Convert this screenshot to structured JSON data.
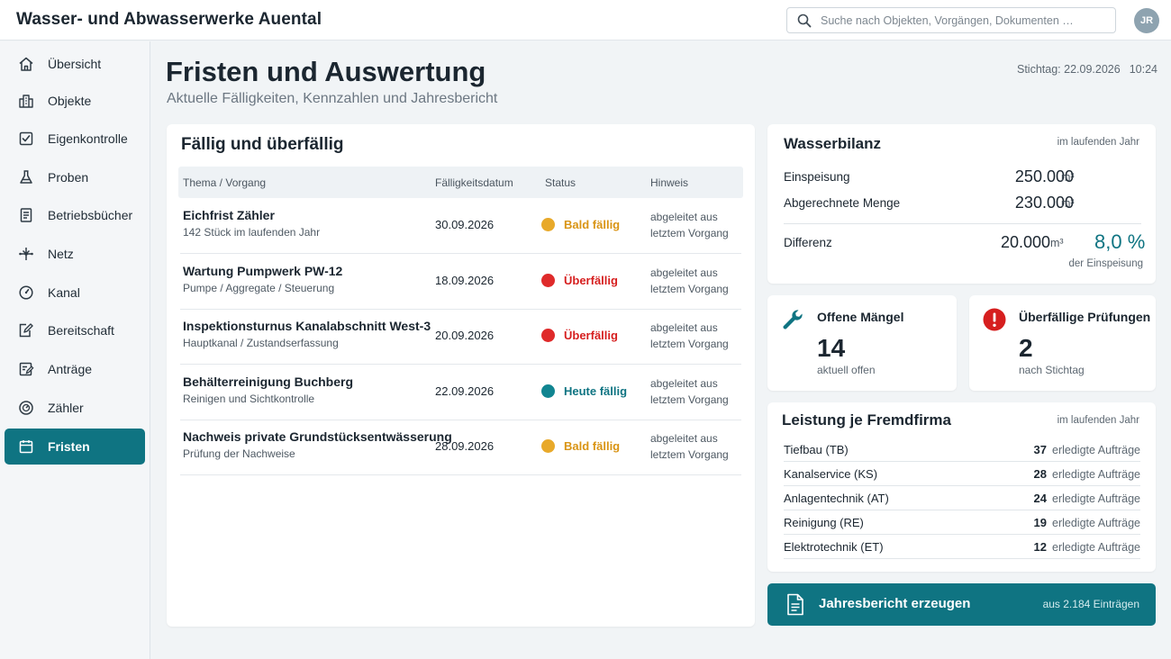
{
  "app": {
    "title": "Wasser- und Abwasserwerke Auental"
  },
  "search": {
    "placeholder": "Suche nach Objekten, Vorgängen, Dokumenten …"
  },
  "user": {
    "initials": "JR"
  },
  "sidebar": {
    "items": [
      {
        "label": "Übersicht",
        "icon": "home-icon"
      },
      {
        "label": "Objekte",
        "icon": "building-icon"
      },
      {
        "label": "Eigenkontrolle",
        "icon": "checkbox-icon"
      },
      {
        "label": "Proben",
        "icon": "flask-icon"
      },
      {
        "label": "Betriebsbücher",
        "icon": "document-icon"
      },
      {
        "label": "Netz",
        "icon": "network-icon"
      },
      {
        "label": "Kanal",
        "icon": "gauge-icon"
      },
      {
        "label": "Bereitschaft",
        "icon": "edit-document-icon"
      },
      {
        "label": "Anträge",
        "icon": "form-icon"
      },
      {
        "label": "Zähler",
        "icon": "meter-icon"
      },
      {
        "label": "Fristen",
        "icon": "calendar-icon",
        "active": true
      }
    ]
  },
  "header": {
    "title": "Fristen und Auswertung",
    "subtitle": "Aktuelle Fälligkeiten, Kennzahlen und Jahresbericht",
    "stichtag": "Stichtag: 22.09.2026",
    "time": "10:24"
  },
  "due": {
    "title": "Fällig und überfällig",
    "columns": [
      "Thema / Vorgang",
      "Fälligkeitsdatum",
      "Status",
      "Hinweis"
    ],
    "rows": [
      {
        "title": "Eichfrist Zähler",
        "sub": "142 Stück im laufenden Jahr",
        "date": "30.09.2026",
        "status": "Bald fällig",
        "hint": "abgeleitet aus letztem Vorgang"
      },
      {
        "title": "Wartung Pumpwerk PW-12",
        "sub": "Pumpe / Aggregate / Steuerung",
        "date": "18.09.2026",
        "status": "Überfällig",
        "hint": "abgeleitet aus letztem Vorgang"
      },
      {
        "title": "Inspektionsturnus Kanalabschnitt West-3",
        "sub": "Hauptkanal / Zustandserfassung",
        "date": "20.09.2026",
        "status": "Überfällig",
        "hint": "abgeleitet aus letztem Vorgang"
      },
      {
        "title": "Behälterreinigung Buchberg",
        "sub": "Reinigen und Sichtkontrolle",
        "date": "22.09.2026",
        "status": "Heute fällig",
        "hint": "abgeleitet aus letztem Vorgang"
      },
      {
        "title": "Nachweis private Grundstücksentwässerung",
        "sub": "Prüfung der Nachweise",
        "date": "28.09.2026",
        "status": "Bald fällig",
        "hint": "abgeleitet aus letztem Vorgang"
      }
    ]
  },
  "status_colors": {
    "Bald fällig": "#e8a92a",
    "Überfällig": "#df2a2a",
    "Heute fällig": "#118591"
  },
  "status_text_colors": {
    "Bald fällig": "#d99414",
    "Überfällig": "#d61f1f",
    "Heute fällig": "#0f7482"
  },
  "wasserbilanz": {
    "title": "Wasserbilanz",
    "period": "im laufenden Jahr",
    "einspeisung_label": "Einspeisung",
    "einspeisung_value": "250.000",
    "abgerechnet_label": "Abgerechnete Menge",
    "abgerechnet_value": "230.000",
    "differenz_label": "Differenz",
    "differenz_value": "20.000",
    "unit": "m³",
    "percent": "8,0 %",
    "percent_note": "der Einspeisung"
  },
  "kpis": {
    "maengel": {
      "title": "Offene Mängel",
      "value": "14",
      "sub": "aktuell offen"
    },
    "pruefungen": {
      "title": "Überfällige Prüfungen",
      "value": "2",
      "sub": "nach Stichtag"
    }
  },
  "fremdfirma": {
    "title": "Leistung je Fremdfirma",
    "period": "im laufenden Jahr",
    "unit": "erledigte Aufträge",
    "rows": [
      {
        "name": "Tiefbau (TB)",
        "count": "37"
      },
      {
        "name": "Kanalservice (KS)",
        "count": "28"
      },
      {
        "name": "Anlagentechnik (AT)",
        "count": "24"
      },
      {
        "name": "Reinigung (RE)",
        "count": "19"
      },
      {
        "name": "Elektrotechnik (ET)",
        "count": "12"
      }
    ]
  },
  "report": {
    "label": "Jahresbericht erzeugen",
    "note": "aus 2.184 Einträgen"
  },
  "colors": {
    "accent": "#0f7482",
    "danger": "#d61f1f"
  }
}
